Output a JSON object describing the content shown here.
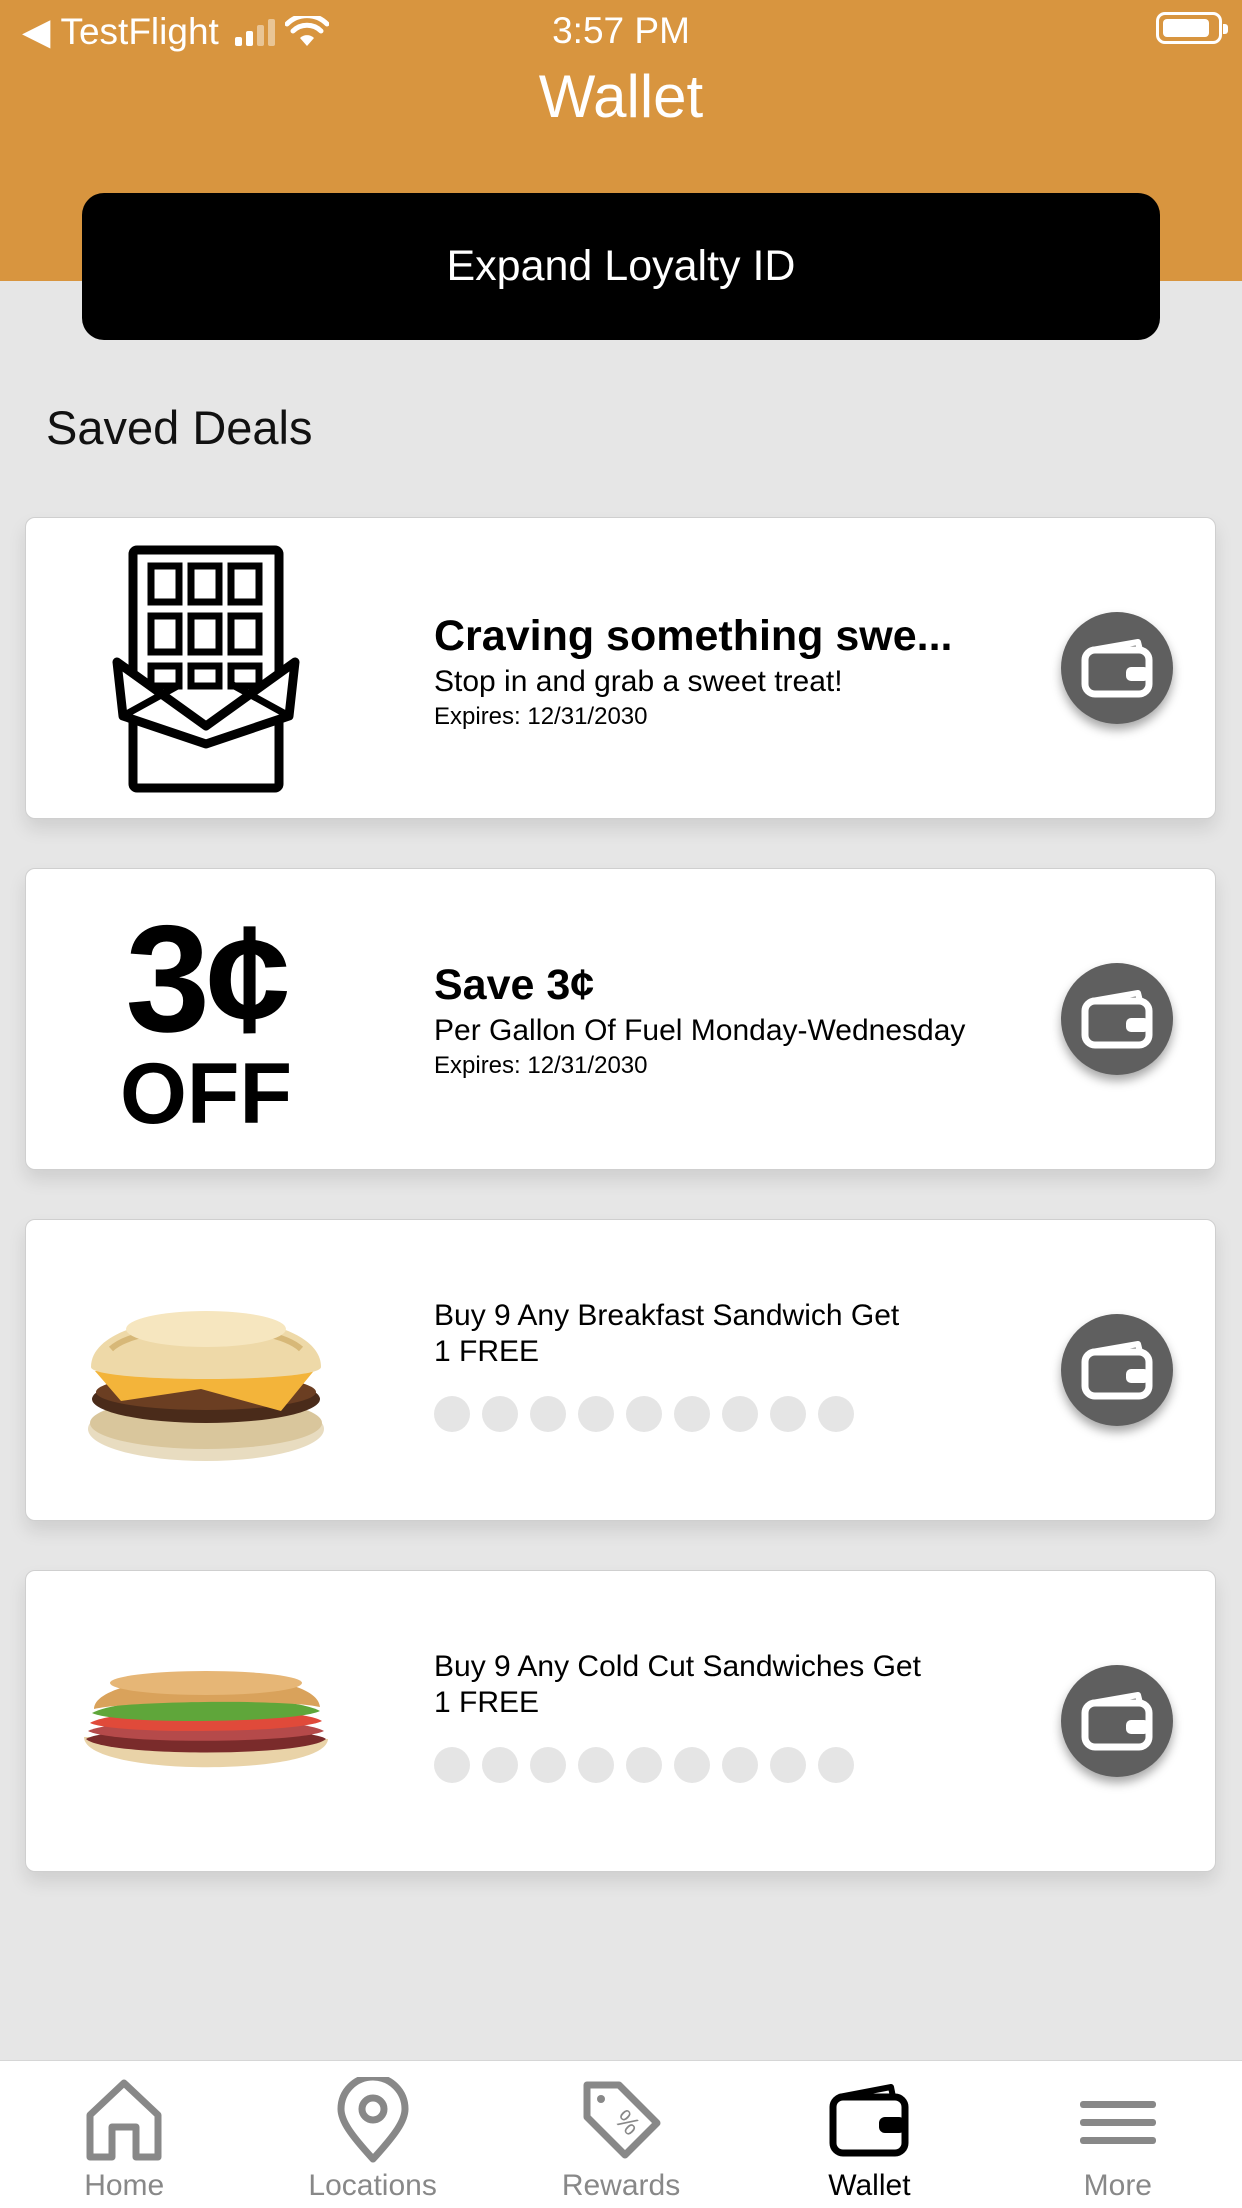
{
  "status_bar": {
    "back_app": "TestFlight",
    "time": "3:57 PM"
  },
  "header": {
    "title": "Wallet",
    "loyalty_button": "Expand Loyalty ID"
  },
  "section_title": "Saved Deals",
  "deals": [
    {
      "image": "chocolate-bar-icon",
      "title": "Craving something swe...",
      "subtitle": "Stop in and grab a sweet treat!",
      "expires": "Expires: 12/31/2030"
    },
    {
      "image_text_top": "3¢",
      "image_text_bottom": "OFF",
      "title": "Save 3¢",
      "subtitle": "Per Gallon Of Fuel Monday-Wednesday",
      "expires": "Expires: 12/31/2030"
    },
    {
      "image": "breakfast-sandwich-photo",
      "name_line1": "Buy 9 Any Breakfast Sandwich Get",
      "name_line2": "1 FREE",
      "punches_total": 9,
      "punches_filled": 0
    },
    {
      "image": "cold-cut-sub-photo",
      "name_line1": "Buy 9 Any Cold Cut Sandwiches Get",
      "name_line2": "1 FREE",
      "punches_total": 9,
      "punches_filled": 0
    }
  ],
  "tabs": [
    {
      "label": "Home",
      "icon": "home-icon",
      "active": false
    },
    {
      "label": "Locations",
      "icon": "location-pin-icon",
      "active": false
    },
    {
      "label": "Rewards",
      "icon": "tag-percent-icon",
      "active": false
    },
    {
      "label": "Wallet",
      "icon": "wallet-icon",
      "active": true
    },
    {
      "label": "More",
      "icon": "menu-icon",
      "active": false
    }
  ],
  "colors": {
    "header": "#d8953f",
    "loyalty_button": "#000000",
    "wallet_button": "#5f5f5f",
    "background": "#e6e6e6"
  }
}
